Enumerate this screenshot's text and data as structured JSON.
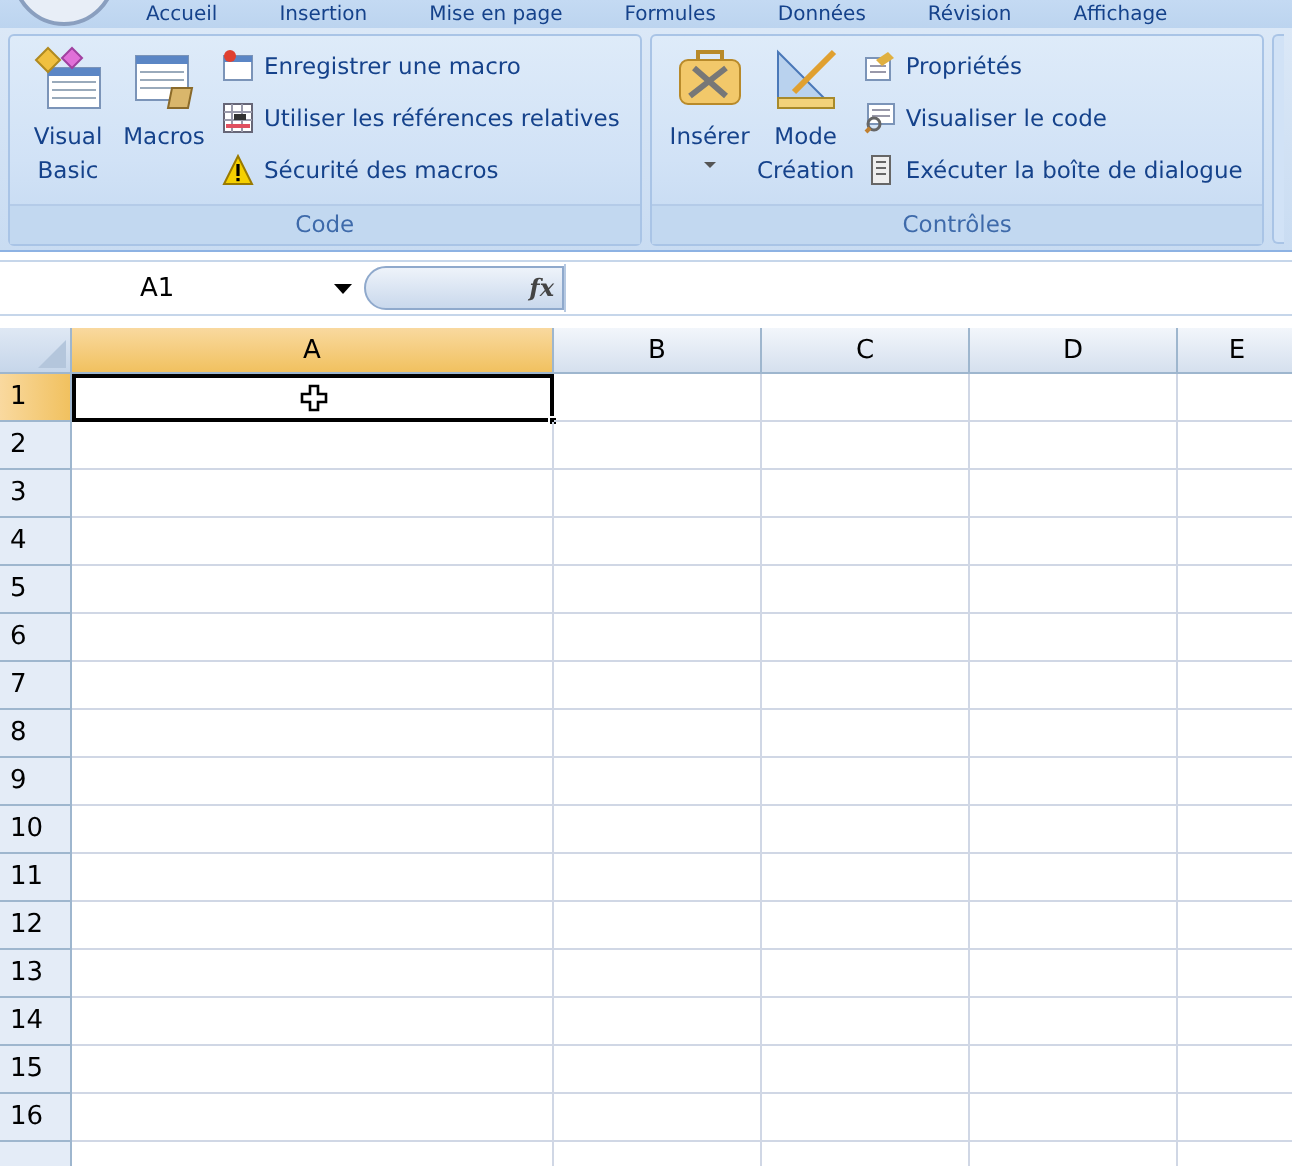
{
  "ribbon_tabs": [
    {
      "label": "Accueil",
      "selected": false
    },
    {
      "label": "Insertion",
      "selected": false
    },
    {
      "label": "Mise en page",
      "selected": false
    },
    {
      "label": "Formules",
      "selected": false
    },
    {
      "label": "Données",
      "selected": false
    },
    {
      "label": "Révision",
      "selected": false
    },
    {
      "label": "Affichage",
      "selected": false
    }
  ],
  "groups": [
    {
      "title": "Code",
      "large_buttons": [
        {
          "label": "Visual Basic",
          "dropdown": false
        },
        {
          "label": "Macros",
          "dropdown": false
        }
      ],
      "small_buttons": [
        {
          "label": "Enregistrer une macro"
        },
        {
          "label": "Utiliser les références relatives"
        },
        {
          "label": "Sécurité des macros"
        }
      ]
    },
    {
      "title": "Contrôles",
      "large_buttons": [
        {
          "label": "Insérer",
          "dropdown": true
        },
        {
          "label": "Mode Création",
          "dropdown": false
        }
      ],
      "small_buttons": [
        {
          "label": "Propriétés"
        },
        {
          "label": "Visualiser le code"
        },
        {
          "label": "Exécuter la boîte de dialogue"
        }
      ]
    }
  ],
  "name_box": {
    "value": "A1"
  },
  "formula_bar": {
    "fx": "fx"
  },
  "columns": [
    {
      "label": "A",
      "selected": true
    },
    {
      "label": "B",
      "selected": false
    },
    {
      "label": "C",
      "selected": false
    },
    {
      "label": "D",
      "selected": false
    },
    {
      "label": "E",
      "selected": false
    }
  ],
  "rows": [
    {
      "label": "1",
      "selected": true
    },
    {
      "label": "2",
      "selected": false
    },
    {
      "label": "3",
      "selected": false
    },
    {
      "label": "4",
      "selected": false
    },
    {
      "label": "5",
      "selected": false
    },
    {
      "label": "6",
      "selected": false
    },
    {
      "label": "7",
      "selected": false
    },
    {
      "label": "8",
      "selected": false
    },
    {
      "label": "9",
      "selected": false
    },
    {
      "label": "10",
      "selected": false
    },
    {
      "label": "11",
      "selected": false
    },
    {
      "label": "12",
      "selected": false
    },
    {
      "label": "13",
      "selected": false
    },
    {
      "label": "14",
      "selected": false
    },
    {
      "label": "15",
      "selected": false
    },
    {
      "label": "16",
      "selected": false
    }
  ]
}
